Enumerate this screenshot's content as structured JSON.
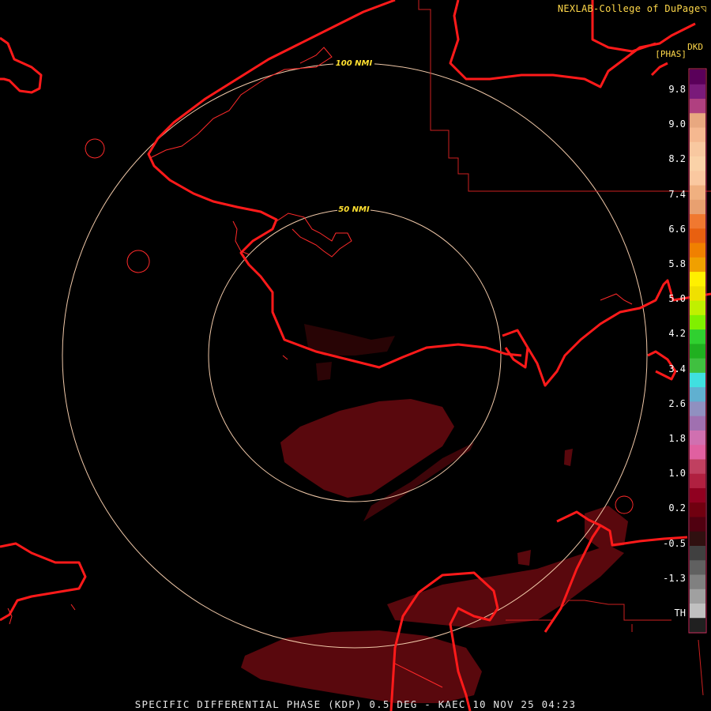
{
  "header": {
    "credit": "NEXLAB-College of DuPage",
    "credit_mark": "◹",
    "product_code": "DKD",
    "unit_label": "[PHAS]"
  },
  "range_rings": [
    {
      "label": "100 NMI"
    },
    {
      "label": "50 NMI"
    }
  ],
  "legend": {
    "ticks": [
      "9.8",
      "9.0",
      "8.2",
      "7.4",
      "6.6",
      "5.8",
      "5.0",
      "4.2",
      "3.4",
      "2.6",
      "1.8",
      "1.0",
      "0.2",
      "-0.5",
      "-1.3",
      "TH"
    ],
    "colors": [
      "#5a005a",
      "#7a1a7a",
      "#b04080",
      "#e8a880",
      "#f5b890",
      "#f8c8a0",
      "#fad2a8",
      "#fac8a0",
      "#f0b080",
      "#e8a070",
      "#f07830",
      "#e86010",
      "#f08000",
      "#f0a000",
      "#fff000",
      "#f0e000",
      "#c0f000",
      "#80f000",
      "#30d030",
      "#20b020",
      "#40c040",
      "#40e0e0",
      "#60b0d0",
      "#9090c0",
      "#a070b0",
      "#d070b0",
      "#e060a0",
      "#c04060",
      "#b02040",
      "#900020",
      "#700010",
      "#500010",
      "#301010",
      "#404040",
      "#606060",
      "#808080",
      "#a0a0a0",
      "#c0c0c0",
      "#202020"
    ]
  },
  "footer": {
    "title": "SPECIFIC DIFFERENTIAL PHASE (KDP) 0.5 DEG - KAEC 10 NOV 25 04:23"
  },
  "colors": {
    "coastline": "#ff1a1a",
    "border": "#cc2020",
    "ring": "#f0c8a8",
    "ring_label": "#ffe030",
    "echo": "#6a0a10"
  }
}
